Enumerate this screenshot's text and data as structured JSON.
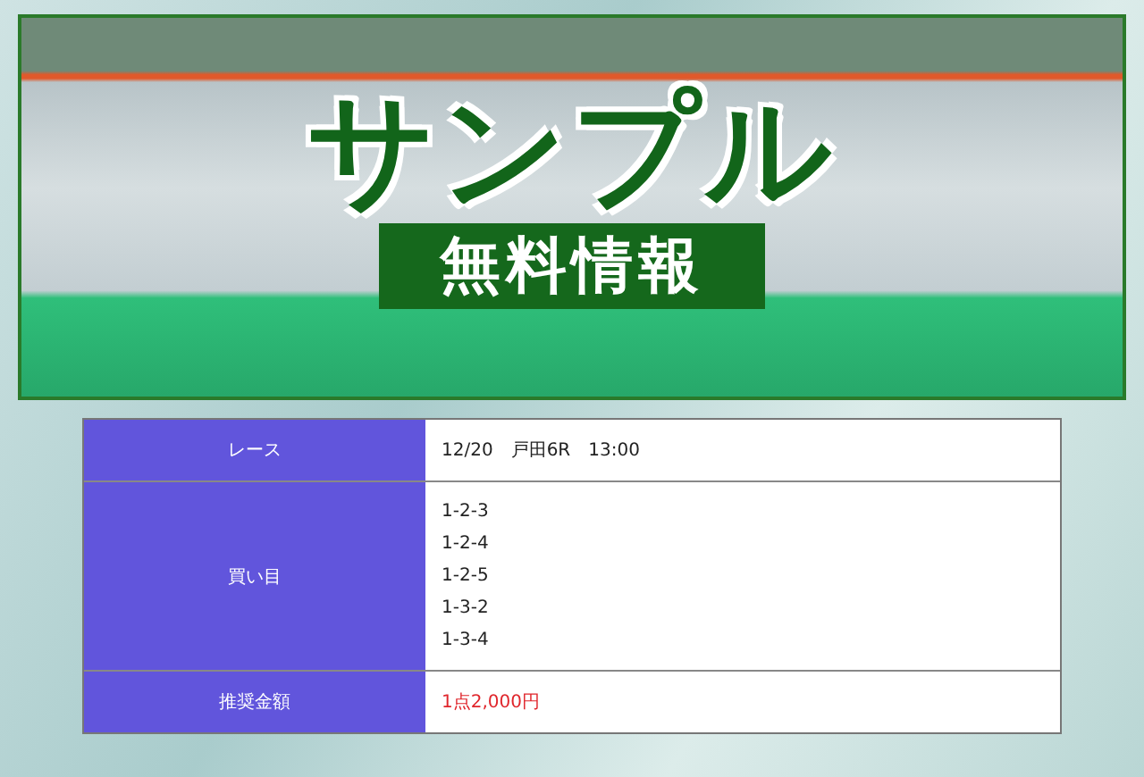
{
  "banner": {
    "title": "サンプル",
    "subtitle": "無料情報"
  },
  "table": {
    "rows": [
      {
        "label": "レース",
        "kind": "plain",
        "lines": [
          "12/20　戸田6R　13:00"
        ]
      },
      {
        "label": "買い目",
        "kind": "plain",
        "lines": [
          "1-2-3",
          "1-2-4",
          "1-2-5",
          "1-3-2",
          "1-3-4"
        ]
      },
      {
        "label": "推奨金額",
        "kind": "highlight",
        "lines": [
          "1点2,000円"
        ]
      }
    ]
  }
}
